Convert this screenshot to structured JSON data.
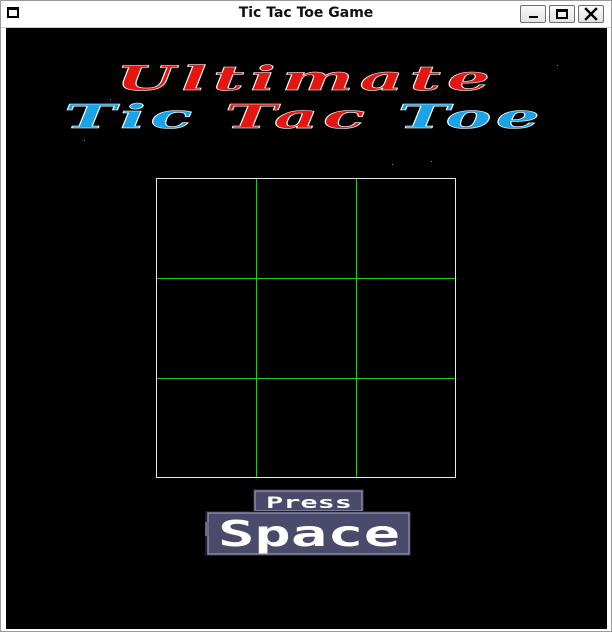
{
  "window": {
    "title": "Tic Tac Toe Game"
  },
  "logo": {
    "line1": "Ultimate",
    "line2": "Tic Tac Toe",
    "line1_color": "#e3170f",
    "line2_blue_color": "#1aa3e6",
    "line2_red_color": "#e3170f"
  },
  "board": {
    "border_color": "#e8e8e8",
    "line_color": "#22c71f",
    "cells": [
      "",
      "",
      "",
      "",
      "",
      "",
      "",
      "",
      ""
    ]
  },
  "prompt": {
    "line1": "Press",
    "line2": "Space",
    "panel_color": "#4a4a6a",
    "text_color": "#ffffff"
  },
  "icons": {
    "app": "window-icon",
    "minimize": "minimize-icon",
    "maximize": "maximize-icon",
    "close": "close-icon"
  }
}
